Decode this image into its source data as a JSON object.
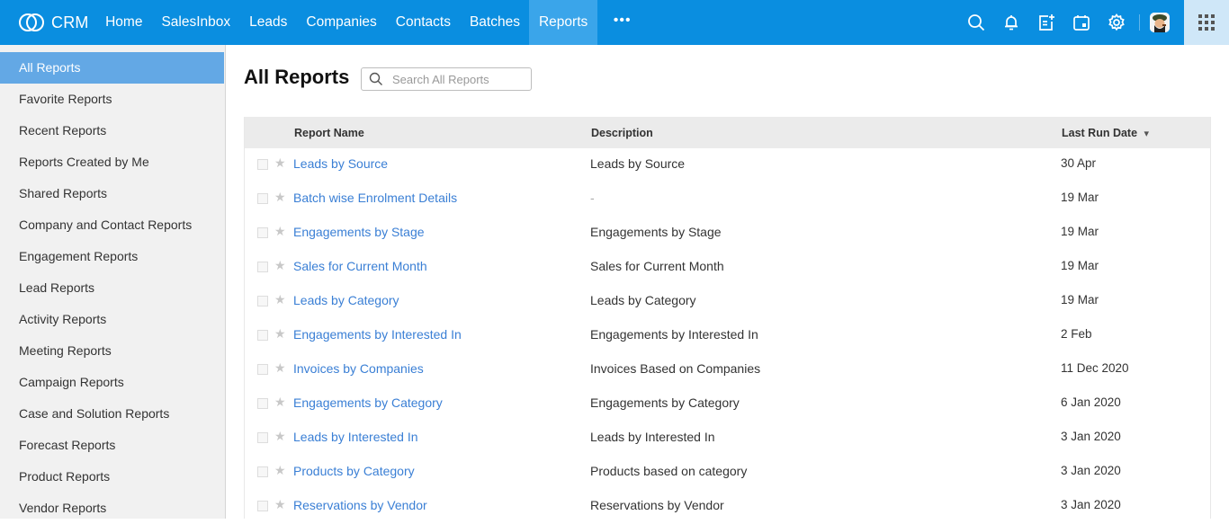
{
  "topbar": {
    "brand": "CRM",
    "nav": [
      "Home",
      "SalesInbox",
      "Leads",
      "Companies",
      "Contacts",
      "Batches",
      "Reports"
    ],
    "active_nav": "Reports",
    "more_label": "•••",
    "icons": [
      "search-icon",
      "bell-icon",
      "add-note-icon",
      "calendar-icon",
      "gear-icon"
    ],
    "apps_icon": "grid-icon"
  },
  "sidebar": {
    "items": [
      "All Reports",
      "Favorite Reports",
      "Recent Reports",
      "Reports Created by Me",
      "Shared Reports",
      "Company and Contact Reports",
      "Engagement Reports",
      "Lead Reports",
      "Activity Reports",
      "Meeting Reports",
      "Campaign Reports",
      "Case and Solution Reports",
      "Forecast Reports",
      "Product Reports",
      "Vendor Reports"
    ],
    "active": "All Reports"
  },
  "main": {
    "title": "All Reports",
    "search_placeholder": "Search All Reports",
    "columns": {
      "name": "Report Name",
      "description": "Description",
      "last_run": "Last Run Date"
    },
    "sort_indicator": "▾",
    "rows": [
      {
        "name": "Leads by Source",
        "description": "Leads by Source",
        "date": "30 Apr"
      },
      {
        "name": "Batch wise Enrolment Details",
        "description": "-",
        "date": "19 Mar"
      },
      {
        "name": "Engagements by Stage",
        "description": "Engagements by Stage",
        "date": "19 Mar"
      },
      {
        "name": "Sales for Current Month",
        "description": "Sales for Current Month",
        "date": "19 Mar"
      },
      {
        "name": "Leads by Category",
        "description": "Leads by Category",
        "date": "19 Mar"
      },
      {
        "name": "Engagements by Interested In",
        "description": "Engagements by Interested In",
        "date": "2 Feb"
      },
      {
        "name": "Invoices by Companies",
        "description": "Invoices Based on Companies",
        "date": "11 Dec 2020"
      },
      {
        "name": "Engagements by Category",
        "description": "Engagements by Category",
        "date": "6 Jan 2020"
      },
      {
        "name": "Leads by Interested In",
        "description": "Leads by Interested In",
        "date": "3 Jan 2020"
      },
      {
        "name": "Products by Category",
        "description": "Products based on category",
        "date": "3 Jan 2020"
      },
      {
        "name": "Reservations by Vendor",
        "description": "Reservations by Vendor",
        "date": "3 Jan 2020"
      }
    ]
  },
  "colors": {
    "topbar": "#0a8ee0",
    "active_nav": "#3aa5ea",
    "sidebar_active": "#63a8e5",
    "link": "#3a7fd5"
  }
}
